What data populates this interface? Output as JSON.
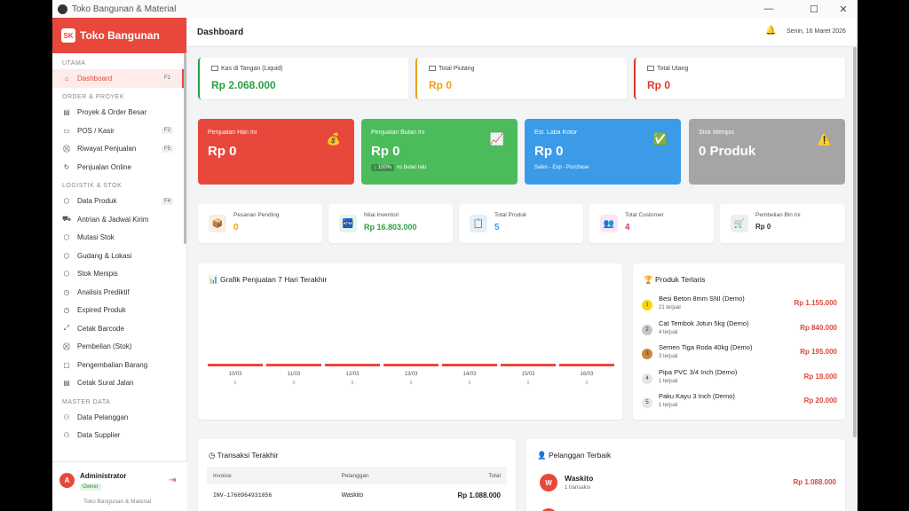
{
  "window": {
    "title": "Toko Bangunan & Material",
    "minimize": "—",
    "maximize": "☐",
    "close": "✕"
  },
  "brand": {
    "logo": "SK",
    "name": "Toko Bangunan"
  },
  "sidebar": {
    "sections": [
      {
        "title": "UTAMA",
        "items": [
          {
            "label": "Dashboard",
            "icon": "home-icon",
            "glyph": "⌂",
            "key": "F1",
            "active": true
          }
        ]
      },
      {
        "title": "ORDER & PROYEK",
        "items": [
          {
            "label": "Proyek & Order Besar",
            "icon": "document-icon",
            "glyph": "▤",
            "key": ""
          },
          {
            "label": "POS / Kasir",
            "icon": "monitor-icon",
            "glyph": "▭",
            "key": "F2"
          },
          {
            "label": "Riwayat Penjualan",
            "icon": "cart-icon",
            "glyph": "⛒",
            "key": "F5"
          },
          {
            "label": "Penjualan Online",
            "icon": "refresh-icon",
            "glyph": "↻",
            "key": ""
          }
        ]
      },
      {
        "title": "LOGISTIK & STOK",
        "items": [
          {
            "label": "Data Produk",
            "icon": "box-icon",
            "glyph": "⬡",
            "key": "F4"
          },
          {
            "label": "Antrian & Jadwal Kirim",
            "icon": "truck-icon",
            "glyph": "⛟",
            "key": ""
          },
          {
            "label": "Mutasi Stok",
            "icon": "box-icon",
            "glyph": "⬡",
            "key": ""
          },
          {
            "label": "Gudang & Lokasi",
            "icon": "box-icon",
            "glyph": "⬡",
            "key": ""
          },
          {
            "label": "Stok Menipis",
            "icon": "box-icon",
            "glyph": "⬡",
            "key": ""
          },
          {
            "label": "Analisis Prediktif",
            "icon": "clock-icon",
            "glyph": "◷",
            "key": ""
          },
          {
            "label": "Expired Produk",
            "icon": "clock-icon",
            "glyph": "◷",
            "key": ""
          },
          {
            "label": "Cetak Barcode",
            "icon": "expand-icon",
            "glyph": "⤢",
            "key": ""
          },
          {
            "label": "Pembelian (Stok)",
            "icon": "cart-icon",
            "glyph": "⛒",
            "key": ""
          },
          {
            "label": "Pengembalian Barang",
            "icon": "clipboard-icon",
            "glyph": "▢",
            "key": ""
          },
          {
            "label": "Cetak Surat Jalan",
            "icon": "document-icon",
            "glyph": "▤",
            "key": ""
          }
        ]
      },
      {
        "title": "MASTER DATA",
        "items": [
          {
            "label": "Data Pelanggan",
            "icon": "users-icon",
            "glyph": "⚇",
            "key": ""
          },
          {
            "label": "Data Supplier",
            "icon": "users-icon",
            "glyph": "⚇",
            "key": ""
          }
        ]
      }
    ]
  },
  "user": {
    "avatar": "A",
    "name": "Administrator",
    "role": "Owner",
    "store": "Toko Bangunan & Material",
    "logout_glyph": "⇥"
  },
  "header": {
    "title": "Dashboard",
    "bell": "🔔",
    "date": "Senin, 16 Maret 2026"
  },
  "kpi": [
    {
      "label": "Kas di Tangan (Liquid)",
      "value": "Rp 2.068.000",
      "color": "#2e9e44"
    },
    {
      "label": "Total Piutang",
      "value": "Rp 0",
      "color": "#e8a317"
    },
    {
      "label": "Total Utang",
      "value": "Rp 0",
      "color": "#d93a2b"
    }
  ],
  "colored_cards": [
    {
      "label": "Penjualan Hari Ini",
      "value": "Rp 0",
      "sub": "",
      "icon": "money-bag-icon",
      "glyph": "💰",
      "bg": "#e8483b"
    },
    {
      "label": "Penjualan Bulan Ini",
      "value": "Rp 0",
      "badge": "↓ 100%",
      "sub": "vs bulan lalu",
      "icon": "chart-up-icon",
      "glyph": "📈",
      "bg": "#4cbb5c"
    },
    {
      "label": "Est. Laba Kotor",
      "value": "Rp 0",
      "sub": "Sales - Exp - Purchase",
      "icon": "check-box-icon",
      "glyph": "✅",
      "bg": "#3b9be8"
    },
    {
      "label": "Stok Menipis",
      "value": "0 Produk",
      "sub": "",
      "icon": "warning-icon",
      "glyph": "⚠️",
      "bg": "#a5a5a5"
    }
  ],
  "stats": [
    {
      "label": "Pesanan Pending",
      "value": "0",
      "icon": "package-icon",
      "glyph": "📦",
      "color": "#e8a317",
      "bg": "#fbeee0"
    },
    {
      "label": "Nilai Inventori",
      "value": "Rp 16.803.000",
      "icon": "cash-register-icon",
      "glyph": "🏧",
      "color": "#2e9e44",
      "bg": "#e6f5e8"
    },
    {
      "label": "Total Produk",
      "value": "5",
      "icon": "clipboard-icon",
      "glyph": "📋",
      "color": "#3b9be8",
      "bg": "#e3f0fc"
    },
    {
      "label": "Total Customer",
      "value": "4",
      "icon": "people-icon",
      "glyph": "👥",
      "color": "#d63a7e",
      "bg": "#fbe6ef"
    },
    {
      "label": "Pembelian Bln Ini",
      "value": "Rp 0",
      "icon": "cart-icon",
      "glyph": "🛒",
      "color": "#333333",
      "bg": "#eeeeee"
    }
  ],
  "sales_chart": {
    "title": "Grafik Penjualan 7 Hari Terakhir",
    "icon": "bar-chart-icon",
    "glyph": "📊"
  },
  "chart_data": {
    "type": "bar",
    "categories": [
      "10/03",
      "11/03",
      "12/03",
      "13/03",
      "14/03",
      "15/03",
      "16/03"
    ],
    "values": [
      0,
      0,
      0,
      0,
      0,
      0,
      0
    ],
    "value_labels": [
      "0",
      "0",
      "0",
      "0",
      "0",
      "0",
      "0"
    ],
    "title": "Grafik Penjualan 7 Hari Terakhir",
    "xlabel": "",
    "ylabel": "",
    "grid": false,
    "color": "#e8483b"
  },
  "top_products": {
    "title": "Produk Terlaris",
    "icon": "trophy-icon",
    "glyph": "🏆",
    "items": [
      {
        "rank": "1",
        "name": "Besi Beton 8mm SNI (Demo)",
        "sold": "21 terjual",
        "value": "Rp 1.155.000",
        "rank_bg": "#f5d90a"
      },
      {
        "rank": "2",
        "name": "Cat Tembok Jotun 5kg (Demo)",
        "sold": "4 terjual",
        "value": "Rp 840.000",
        "rank_bg": "#c7c7c7"
      },
      {
        "rank": "3",
        "name": "Semen Tiga Roda 40kg (Demo)",
        "sold": "3 terjual",
        "value": "Rp 195.000",
        "rank_bg": "#c8873d"
      },
      {
        "rank": "4",
        "name": "Pipa PVC 3/4 Inch (Demo)",
        "sold": "1 terjual",
        "value": "Rp 18.000",
        "rank_bg": "#e5e5e5"
      },
      {
        "rank": "5",
        "name": "Paku Kayu 3 Inch (Demo)",
        "sold": "1 terjual",
        "value": "Rp 20.000",
        "rank_bg": "#e5e5e5"
      }
    ]
  },
  "transactions": {
    "title": "Transaksi Terakhir",
    "icon": "clock-icon",
    "glyph": "◷",
    "columns": [
      "Invoice",
      "Pelanggan",
      "Total"
    ],
    "rows": [
      [
        "INV-1768964931856",
        "Waskito",
        "Rp 1.088.000"
      ]
    ]
  },
  "top_customers": {
    "title": "Pelanggan Terbaik",
    "icon": "person-icon",
    "glyph": "👤",
    "items": [
      {
        "avatar": "W",
        "name": "Waskito",
        "tx": "1 transaksi",
        "value": "Rp 1.088.000"
      }
    ]
  }
}
